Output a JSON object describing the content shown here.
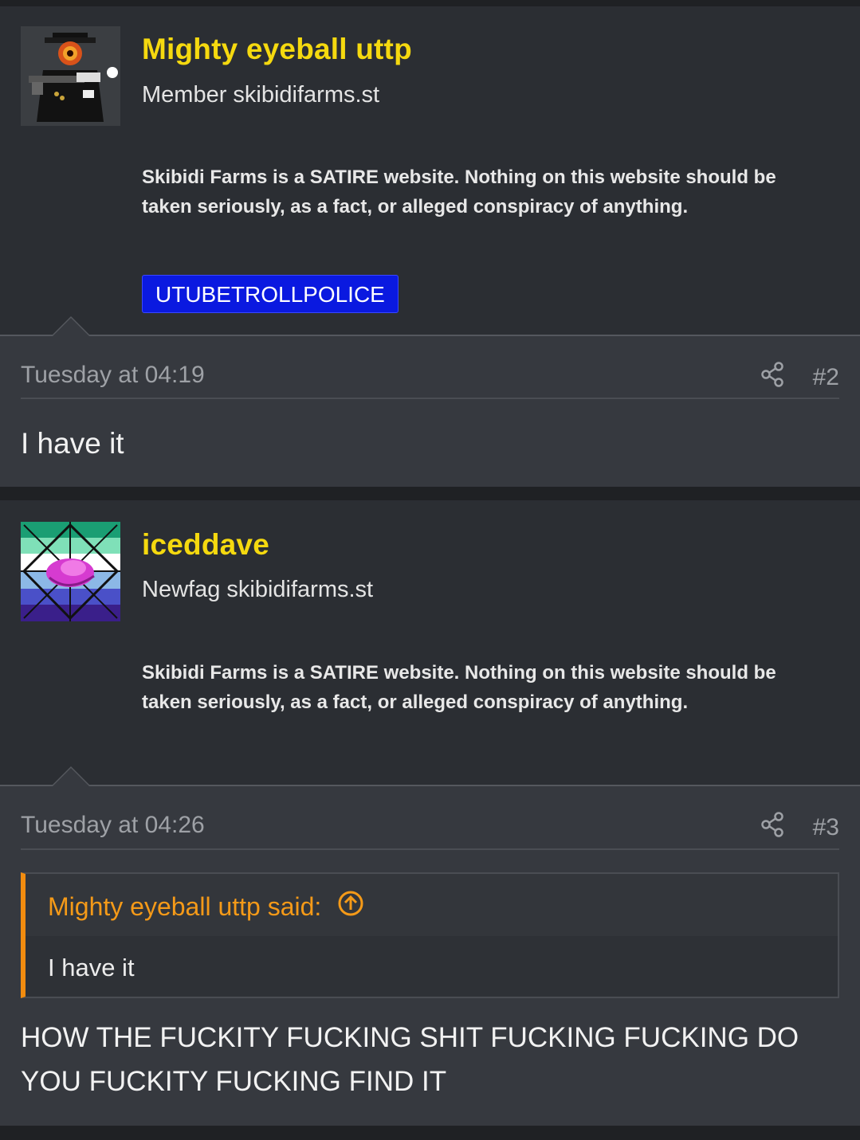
{
  "posts": [
    {
      "username": "Mighty eyeball uttp",
      "usertitle": "Member skibidifarms.st",
      "signature": "Skibidi Farms is a SATIRE website. Nothing on this website should be taken seriously, as a fact, or alleged conspiracy of anything.",
      "banner": "UTUBETROLLPOLICE",
      "date": "Tuesday at 04:19",
      "post_number": "#2",
      "body": "I have it",
      "avatar_icon": "soldier-eyeball-avatar"
    },
    {
      "username": "iceddave",
      "usertitle": "Newfag skibidifarms.st",
      "signature": "Skibidi Farms is a SATIRE website. Nothing on this website should be taken seriously, as a fact, or alleged conspiracy of anything.",
      "date": "Tuesday at 04:26",
      "post_number": "#3",
      "quote": {
        "author": "Mighty eyeball uttp said:",
        "text": "I have it"
      },
      "body": "HOW THE FUCKITY FUCKING SHIT FUCKING FUCKING DO YOU FUCKITY FUCKING FIND IT",
      "avatar_icon": "rune-pattern-avatar"
    }
  ],
  "colors": {
    "username": "#f5d90f",
    "banner_bg": "#0a19e0",
    "quote_accent": "#f28c0f"
  }
}
